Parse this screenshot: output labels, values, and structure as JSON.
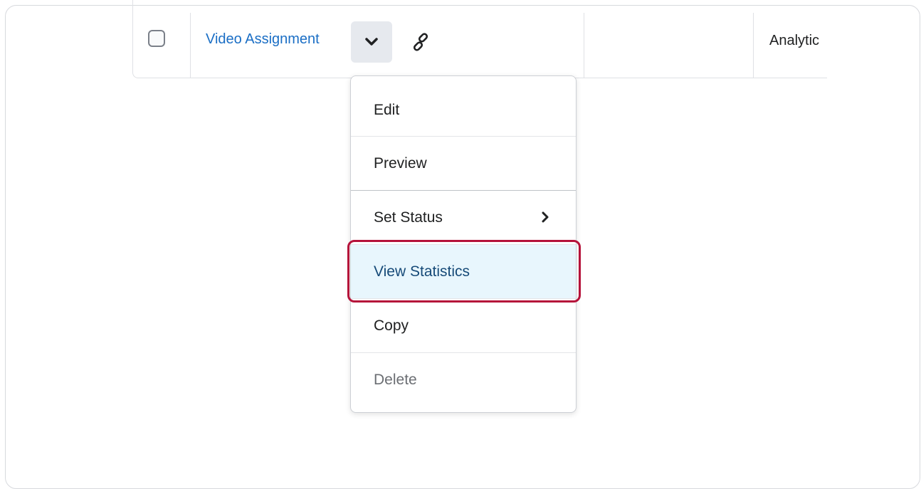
{
  "table_row": {
    "item_title": "Video Assignment",
    "dropdown_icon": "chevron-down-icon",
    "link_icon": "link-icon",
    "next_column_text": "Analytic"
  },
  "context_menu": {
    "items": [
      {
        "label": "Edit"
      },
      {
        "label": "Preview"
      },
      {
        "label": "Set Status",
        "submenu_icon": "chevron-right-icon"
      },
      {
        "label": "View Statistics",
        "state": "highlighted"
      },
      {
        "label": "Copy"
      },
      {
        "label": "Delete",
        "state": "muted"
      }
    ]
  },
  "colors": {
    "link": "#1a6ec5",
    "highlight_bg": "#e8f6fd",
    "highlight_ring": "#b5123a"
  }
}
